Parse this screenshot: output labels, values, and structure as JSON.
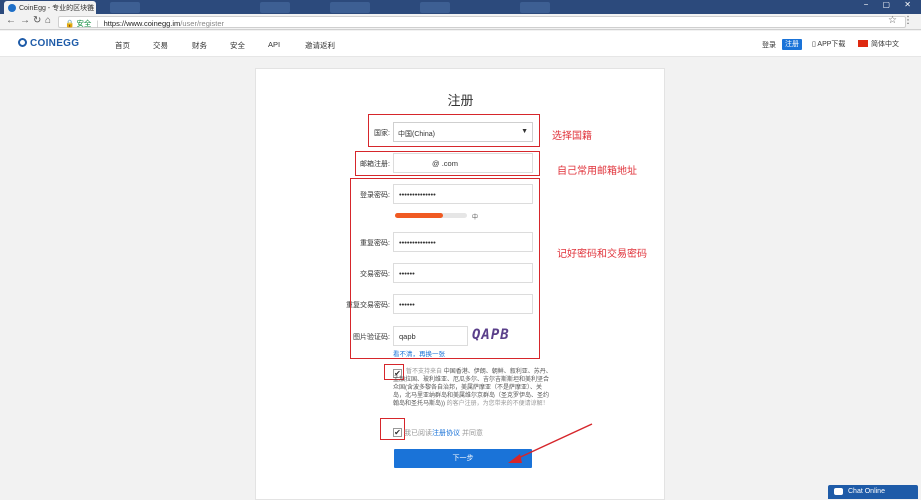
{
  "browser": {
    "tab_title": "CoinEgg - 专业的区块链",
    "tab_close": "×",
    "security_label": "安全",
    "url_host": "https://www.coinegg.im",
    "url_path": "/user/register"
  },
  "header": {
    "logo": "COINEGG",
    "nav": [
      "首页",
      "交易",
      "财务",
      "安全",
      "API",
      "邀请返利"
    ],
    "login": "登录",
    "register": "注册",
    "app_download": "APP下载",
    "language": "简体中文"
  },
  "form": {
    "title": "注册",
    "country_label": "国家:",
    "country_value": "中国(China)",
    "email_label": "邮箱注册:",
    "email_value": "@      .com",
    "password_label": "登录密码:",
    "password_value": "••••••••••••••",
    "strength_label": "中",
    "strength_level": 0.67,
    "confirm_password_label": "重复密码:",
    "confirm_password_value": "••••••••••••••",
    "trade_password_label": "交易密码:",
    "trade_password_value": "••••••",
    "confirm_trade_password_label": "重复交易密码:",
    "confirm_trade_password_value": "••••••",
    "captcha_label": "图片验证码:",
    "captcha_value": "qapb",
    "captcha_image_text": "QAPB",
    "captcha_refresh": "看不清，再换一张",
    "notice_gray_1": "暂不支持来自",
    "notice_text": "中国香港、伊朗、朝鲜、叙利亚、苏丹、孟加拉国、玻利维亚、厄瓜多尔、吉尔吉斯斯坦和美利坚合众国(含波多黎各自治邦，美属萨摩亚（不是萨摩亚）、关岛，北马里亚纳群岛和美属维尔京群岛（圣克罗伊岛、圣约翰岛和圣托马斯岛))",
    "notice_gray_2": "的客户注册，为您带来的不便请谅解！",
    "agree_prefix": "我已阅读",
    "agree_link": "注册协议",
    "agree_suffix": "并同意",
    "next_button": "下一步"
  },
  "annotations": {
    "note_country": "选择国籍",
    "note_email": "自己常用邮箱地址",
    "note_passwords": "记好密码和交易密码"
  },
  "chat": {
    "label": "Chat Online"
  },
  "colors": {
    "brand_blue": "#1a73d8",
    "annotation_red": "#d6262b",
    "strength_orange": "#f05a22"
  }
}
